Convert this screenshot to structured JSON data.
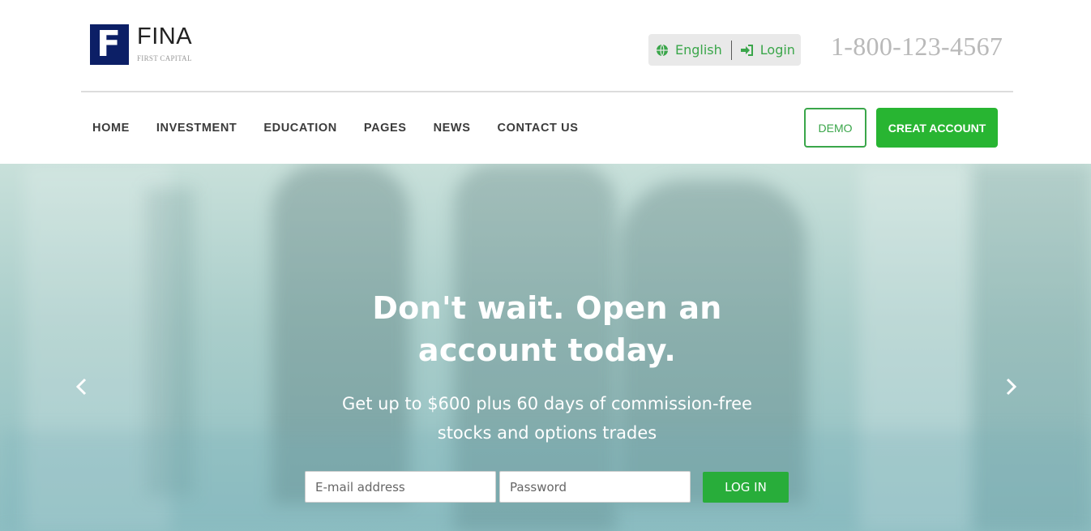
{
  "brand": {
    "name": "FINA",
    "tagline": "FIRST CAPITAL",
    "logo_letter": "F",
    "color": "#0c1f66"
  },
  "topbar": {
    "language_label": "English",
    "language_icon": "globe-icon",
    "login_label": "Login",
    "login_icon": "sign-in-icon",
    "phone": "1-800-123-4567"
  },
  "nav": {
    "items": [
      "HOME",
      "INVESTMENT",
      "EDUCATION",
      "PAGES",
      "NEWS",
      "CONTACT US"
    ],
    "demo_label": "DEMO",
    "create_label": "CREAT ACCOUNT"
  },
  "hero": {
    "title": "Don't wait. Open an account today.",
    "subtitle": "Get up to $600 plus 60 days of commission-free stocks and options trades",
    "email_placeholder": "E-mail address",
    "password_placeholder": "Password",
    "login_button": "LOG IN",
    "prev_icon": "chevron-left-icon",
    "next_icon": "chevron-right-icon"
  },
  "colors": {
    "accent": "#28b532",
    "brand": "#0c1f66",
    "phone": "#b9b9b9"
  }
}
